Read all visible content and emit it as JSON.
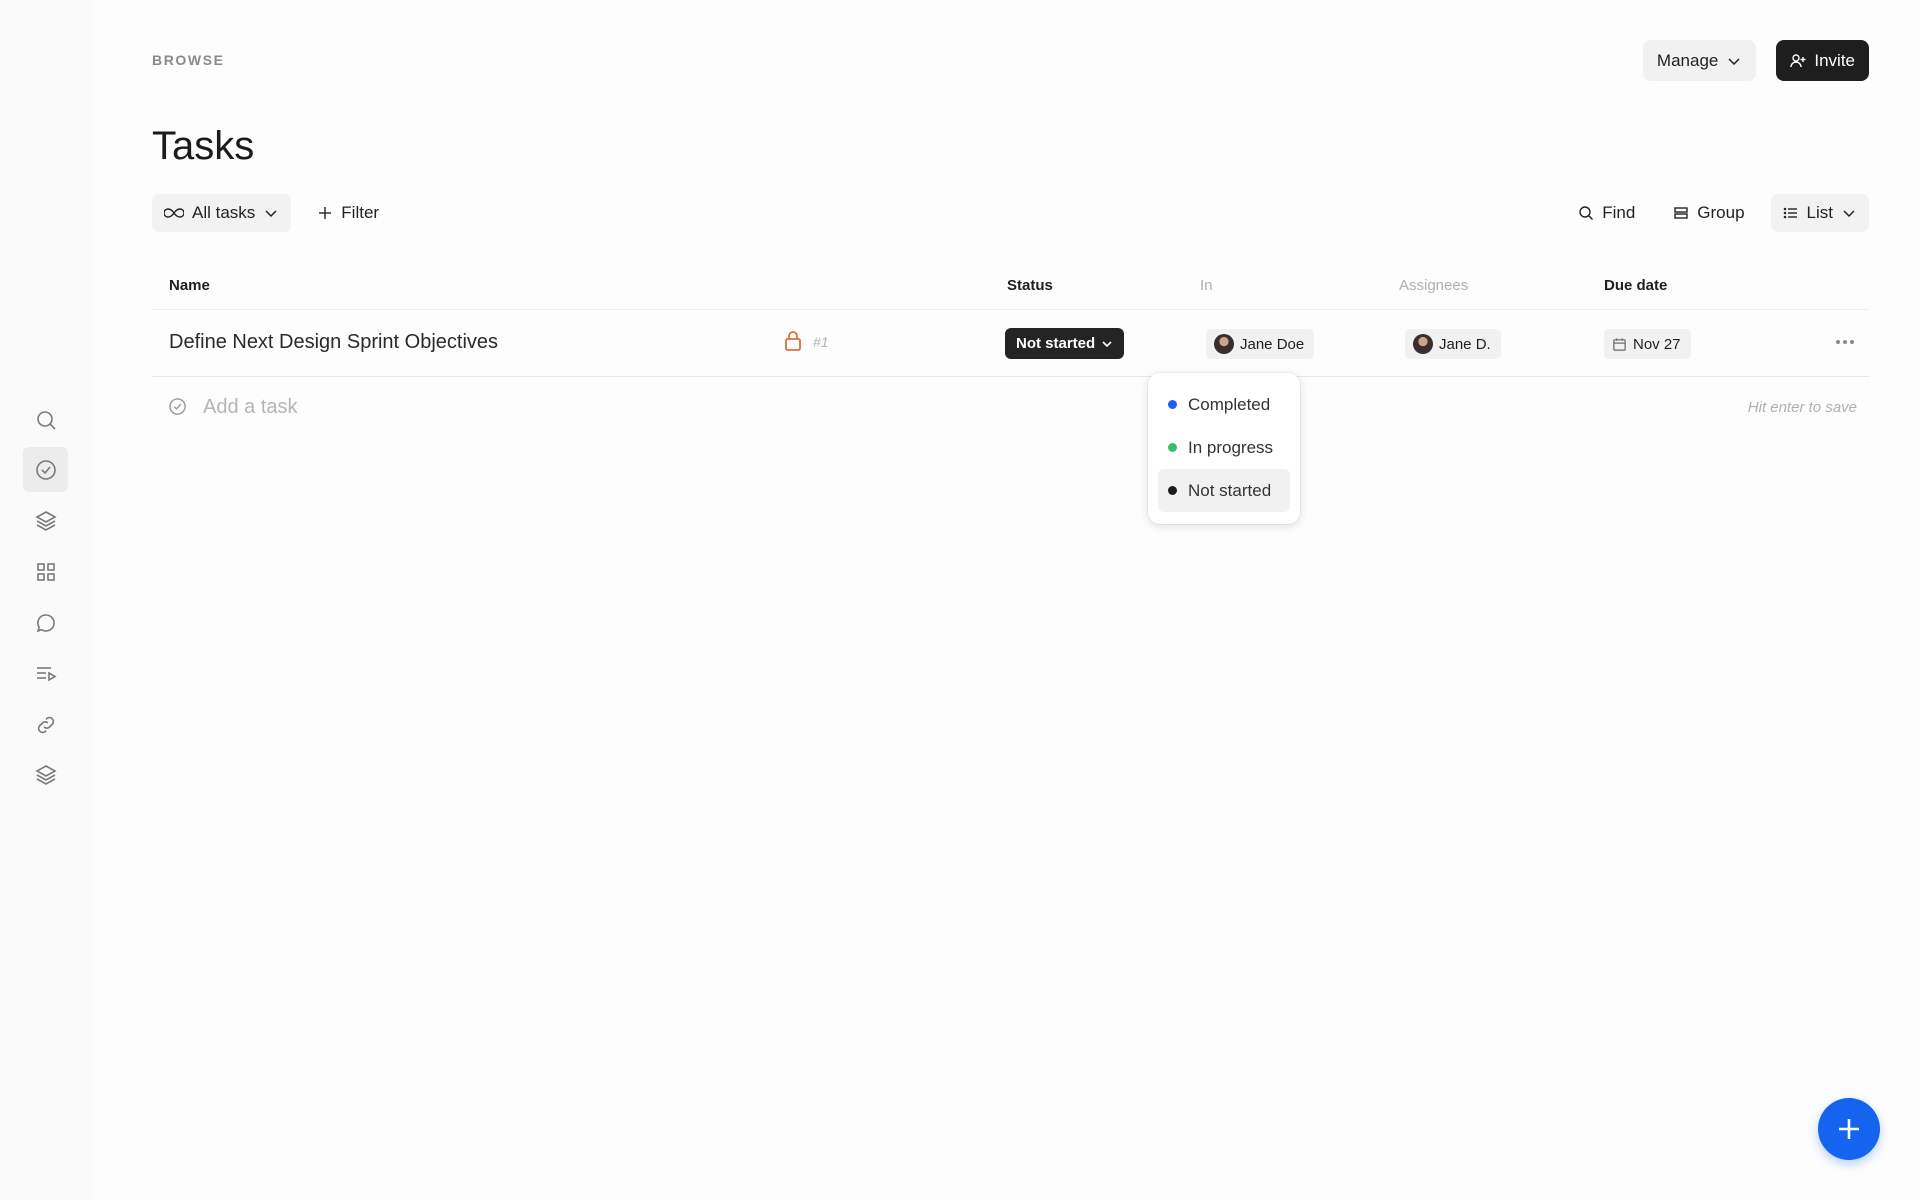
{
  "header": {
    "breadcrumb": "BROWSE",
    "title": "Tasks",
    "manage_label": "Manage",
    "invite_label": "Invite"
  },
  "toolbar": {
    "all_tasks_label": "All tasks",
    "filter_label": "Filter",
    "find_label": "Find",
    "group_label": "Group",
    "view_label": "List"
  },
  "table": {
    "columns": [
      "Name",
      "Status",
      "In",
      "Assignees",
      "Due date"
    ],
    "rows": [
      {
        "name": "Define Next Design Sprint Objectives",
        "number": "#1",
        "status": "Not started",
        "in": "Jane Doe",
        "assignee": "Jane D.",
        "due": "Nov 27"
      }
    ],
    "add_placeholder": "Add a task",
    "add_hint": "Hit enter to save"
  },
  "status_dropdown": {
    "options": [
      {
        "label": "Completed",
        "color": "#1f5eea"
      },
      {
        "label": "In progress",
        "color": "#3cba6e"
      },
      {
        "label": "Not started",
        "color": "#1c1c1c"
      }
    ],
    "selected": "Not started"
  },
  "sidebar": {
    "icons": [
      "search-icon",
      "check-circle-icon",
      "layers-icon",
      "grid-icon",
      "chat-icon",
      "playlist-icon",
      "link-icon",
      "stack-icon"
    ],
    "active": "check-circle-icon"
  },
  "colors": {
    "accent": "#1564f0",
    "lock": "#e0703a"
  }
}
